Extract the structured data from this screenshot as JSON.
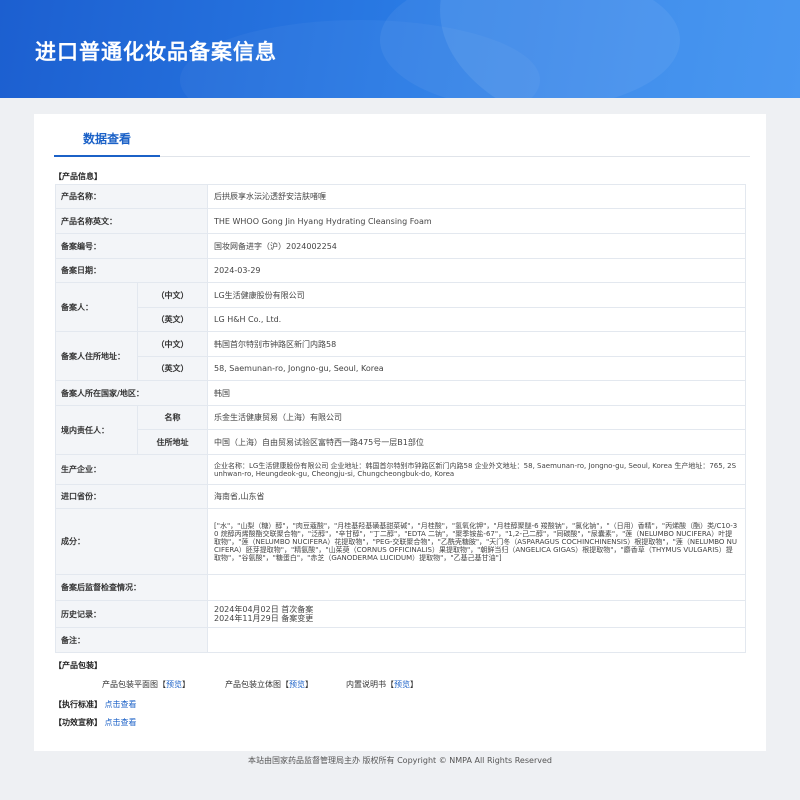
{
  "header": {
    "title": "进口普通化妆品备案信息"
  },
  "tab": {
    "label": "数据查看"
  },
  "sections": {
    "product_info": "【产品信息】",
    "package": "【产品包装】",
    "standard": "【执行标准】",
    "efficacy": "【功效宣称】"
  },
  "rows": {
    "name": {
      "label": "产品名称：",
      "value": "后拱辰享水沄沁透舒安洁肤啫喱"
    },
    "name_en": {
      "label": "产品名称英文：",
      "value": "THE WHOO Gong Jin Hyang Hydrating Cleansing Foam"
    },
    "reg_no": {
      "label": "备案编号：",
      "value": "国妆网备进字（沪）2024002254"
    },
    "reg_date": {
      "label": "备案日期：",
      "value": "2024-03-29"
    },
    "registrant": {
      "label": "备案人：",
      "cn_label": "（中文）",
      "cn_value": "LG生活健康股份有限公司",
      "en_label": "（英文）",
      "en_value": "LG H&H Co., Ltd."
    },
    "registrant_addr": {
      "label": "备案人住所地址：",
      "cn_label": "（中文）",
      "cn_value": "韩国首尔特别市钟路区新门内路58",
      "en_label": "（英文）",
      "en_value": "58, Saemunan-ro, Jongno-gu, Seoul, Korea"
    },
    "country": {
      "label": "备案人所在国家/地区：",
      "value": "韩国"
    },
    "agent": {
      "label": "境内责任人：",
      "name_label": "名称",
      "name_value": "乐金生活健康贸易（上海）有限公司",
      "addr_label": "住所地址",
      "addr_value": "中国（上海）自由贸易试验区富特西一路475号一层B1部位"
    },
    "manufacturer": {
      "label": "生产企业：",
      "value": "企业名称：LG生活健康股份有限公司 企业地址：韩国首尔特别市钟路区新门内路58 企业外文地址：58, Saemunan-ro, Jongno-gu, Seoul, Korea 生产地址：765, 2Sunhwan-ro, Heungdeok-gu, Cheongju-si, Chungcheongbuk-do, Korea"
    },
    "port": {
      "label": "进口省份：",
      "value": "海南省,山东省"
    },
    "ingredients": {
      "label": "成分：",
      "value": "[\"水\"，\"山梨（糖）醇\"，\"肉豆蔻酸\"，\"月桂基羟基磺基甜菜碱\"，\"月桂酸\"，\"氢氧化钾\"，\"月桂醇聚醚-6 羧酸钠\"，\"氯化钠\"，\"（日用）香精\"，\"丙烯酸（酯）类/C10-30 烷醇丙烯酸酯交联聚合物\"，\"泛醇\"，\"辛甘醇\"，\"丁二醇\"，\"EDTA 二钠\"，\"聚季铵盐-67\"，\"1,2-己二醇\"，\"同碳酸\"，\"尿囊素\"，\"莲（NELUMBO NUCIFERA）叶提取物\"，\"莲（NELUMBO NUCIFERA）花提取物\"，\"PEG-交联聚合物\"，\"乙酰壳糖胺\"，\"天门冬（ASPARAGUS COCHINCHINENSIS）根提取物\"，\"莲（NELUMBO NUCIFERA）胚芽提取物\"，\"精氨酸\"，\"山茱萸（CORNUS OFFICINALIS）果提取物\"，\"朝鲜当归（ANGELICA GIGAS）根提取物\"，\"麝香草（THYMUS VULGARIS）提取物\"，\"谷氨酸\"，\"糖蛋白\"，\"赤芝（GANODERMA LUCIDUM）提取物\"，\"乙基己基甘油\"]"
    },
    "inspection": {
      "label": "备案后监督检查情况：",
      "value": ""
    },
    "history": {
      "label": "历史记录：",
      "line1": "2024年04月02日 首次备案",
      "line2": "2024年11月29日 备案变更"
    },
    "remark": {
      "label": "备注：",
      "value": ""
    }
  },
  "package": {
    "flat_label": "产品包装平面图",
    "three_d_label": "产品包装立体图",
    "manual_label": "内置说明书",
    "lbracket": "【",
    "rbracket": "】",
    "preview": "预览"
  },
  "links": {
    "view": "点击查看"
  },
  "footer": {
    "text": "本站由国家药品监督管理局主办 版权所有 Copyright © NMPA All Rights Reserved"
  }
}
